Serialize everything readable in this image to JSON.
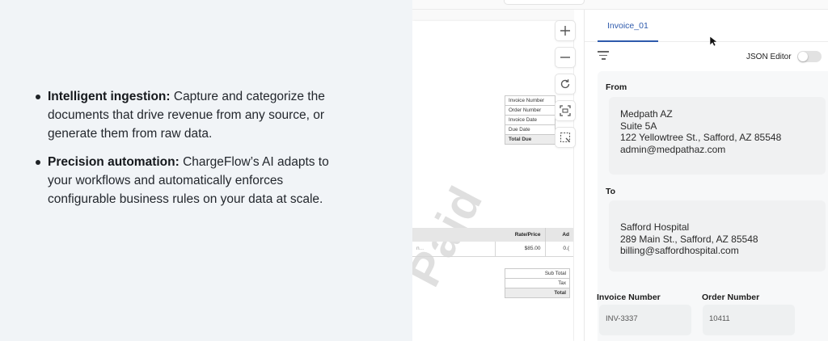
{
  "marketing": {
    "bullets": [
      {
        "bold": "Intelligent ingestion:",
        "text": " Capture and categorize the documents that drive revenue from any source, or generate them from raw data."
      },
      {
        "bold": "Precision automation:",
        "text": " ChargeFlow’s AI adapts to your workflows and automatically enforces configurable business rules on your data at scale."
      }
    ]
  },
  "document": {
    "meta_rows": [
      "Invoice Number",
      "Order Number",
      "Invoice Date",
      "Due Date",
      "Total Due"
    ],
    "items_header": [
      "Rate/Price",
      "Ad"
    ],
    "items_row": {
      "desc": "n...",
      "rate": "$85.00",
      "amount": "0.("
    },
    "totals": [
      "Sub Total",
      "Tax",
      "Total"
    ],
    "watermark": "Paid"
  },
  "tools": {
    "icons": [
      "zoom-in-icon",
      "zoom-out-icon",
      "rotate-icon",
      "fit-to-screen-icon",
      "selection-icon"
    ]
  },
  "panel": {
    "tab": "Invoice_01",
    "json_editor_label": "JSON Editor",
    "json_editor_on": false,
    "from": {
      "label": "From",
      "lines": [
        "Medpath AZ",
        "Suite 5A",
        "122 Yellowtree St., Safford, AZ 85548",
        "admin@medpathaz.com"
      ]
    },
    "to": {
      "label": "To",
      "lines": [
        "Safford Hospital",
        "289 Main St., Safford, AZ 85548",
        "billing@saffordhospital.com"
      ]
    },
    "invoice_number": {
      "label": "Invoice Number",
      "value": "INV-3337"
    },
    "order_number": {
      "label": "Order Number",
      "value": "10411"
    }
  }
}
